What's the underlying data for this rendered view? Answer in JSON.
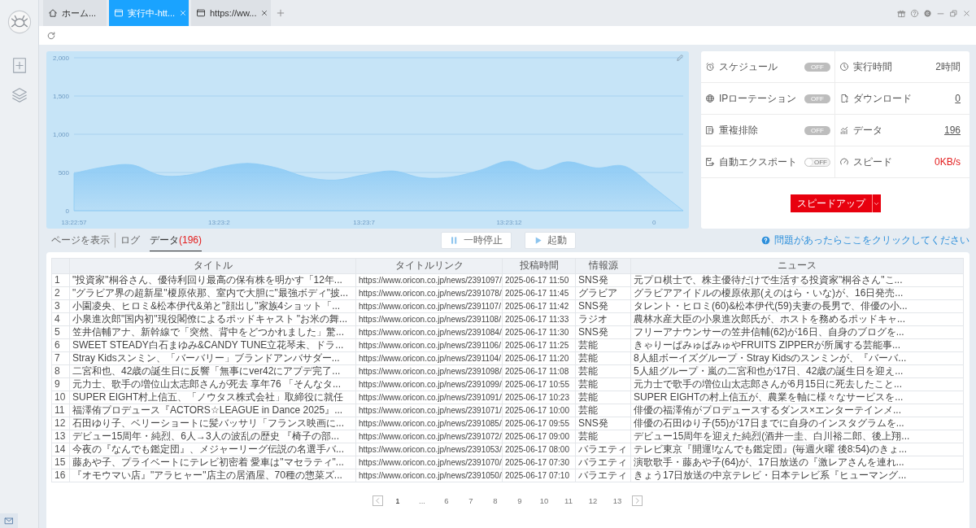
{
  "tabs": [
    {
      "label": "ホーム...",
      "kind": "home",
      "selected": false,
      "closable": false
    },
    {
      "label": "実行中-htt...",
      "kind": "page",
      "selected": true,
      "closable": true
    },
    {
      "label": "https://ww...",
      "kind": "page",
      "selected": false,
      "closable": true
    }
  ],
  "speed_chart": {
    "chart_data": {
      "type": "area",
      "categories": [
        "13:22:57",
        null,
        null,
        null,
        null,
        "13:23:2",
        null,
        null,
        null,
        null,
        "13:23:7",
        null,
        null,
        null,
        null,
        "13:23:12",
        null,
        null,
        null,
        null,
        "0",
        null
      ],
      "series": [
        {
          "color": "#8ecbf5",
          "values": [
            490,
            570,
            600,
            460,
            470,
            570,
            620,
            560,
            440,
            400,
            470,
            520,
            430,
            440,
            530,
            650,
            530,
            640,
            560,
            580,
            300,
            0
          ]
        }
      ],
      "ylim": [
        0,
        2000
      ],
      "grid": true,
      "yticks": [
        {
          "value": 0,
          "label": "0"
        },
        {
          "value": 500,
          "label": "500"
        },
        {
          "value": 1000,
          "label": "1,000"
        },
        {
          "value": 1500,
          "label": "1,500"
        },
        {
          "value": 2000,
          "label": "2,000"
        }
      ]
    }
  },
  "toggles": [
    {
      "label": "スケジュール",
      "kind": "pill",
      "state": "OFF",
      "on": false
    },
    {
      "label": "IPローテーション",
      "kind": "pill",
      "state": "OFF",
      "on": false
    },
    {
      "label": "重複排除",
      "kind": "pill",
      "state": "OFF",
      "on": false
    },
    {
      "label": "自動エクスポート",
      "kind": "switch",
      "state": "OFF",
      "on": false
    }
  ],
  "stats": [
    {
      "label": "実行時間",
      "value": "2時間",
      "kind": "text"
    },
    {
      "label": "ダウンロード",
      "value": "0",
      "kind": "link"
    },
    {
      "label": "データ",
      "value": "196",
      "kind": "link"
    },
    {
      "label": "スピード",
      "value": "0KB/s",
      "kind": "alert"
    }
  ],
  "speed_button": {
    "label": "スピードアップ"
  },
  "view_tabs": [
    {
      "label": "ページを表示",
      "selected": false
    },
    {
      "label": "ログ",
      "selected": false
    },
    {
      "label": "データ",
      "count": "(196)",
      "selected": true
    }
  ],
  "actions": [
    {
      "label": "一時停止",
      "kind": "pause"
    },
    {
      "label": "起動",
      "kind": "play"
    }
  ],
  "help_link": "問題があったらここをクリックしてください",
  "table": {
    "columns": [
      "タイトル",
      "タイトルリンク",
      "投稿時間",
      "情報源",
      "ニュース"
    ],
    "rows": [
      {
        "index": "1",
        "title": "\"投資家\"桐谷さん、優待利回り最高の保有株を明かす「12年...",
        "link": "https://www.oricon.co.jp/news/2391097/",
        "time": "2025-06-17 11:50",
        "source": "SNS発",
        "news": "元プロ棋士で、株主優待だけで生活する投資家\"桐谷さん\"こ..."
      },
      {
        "index": "2",
        "title": "\"グラビア界の超新星\"榎原依那、室内で大胆に\"最強ボディ\"披...",
        "link": "https://www.oricon.co.jp/news/2391078/",
        "time": "2025-06-17 11:45",
        "source": "グラビア",
        "news": "グラビアアイドルの榎原依那(えのはら・いな)が、16日発売..."
      },
      {
        "index": "3",
        "title": "小園凌央、ヒロミ&松本伊代&弟と\"顔出し\"家族4ショット「...",
        "link": "https://www.oricon.co.jp/news/2391107/",
        "time": "2025-06-17 11:42",
        "source": "SNS発",
        "news": "タレント・ヒロミ(60)&松本伊代(59)夫妻の長男で、俳優の小..."
      },
      {
        "index": "4",
        "title": "小泉進次郎\"国内初\"現役閣僚によるポッドキャスト \"お米の舞...",
        "link": "https://www.oricon.co.jp/news/2391108/",
        "time": "2025-06-17 11:33",
        "source": "ラジオ",
        "news": "農林水産大臣の小泉進次郎氏が、ホストを務めるポッドキャ..."
      },
      {
        "index": "5",
        "title": "笠井信輔アナ、新幹線で「突然、背中をどつかれました」驚...",
        "link": "https://www.oricon.co.jp/news/2391084/",
        "time": "2025-06-17 11:30",
        "source": "SNS発",
        "news": "フリーアナウンサーの笠井信輔(62)が16日、自身のブログを..."
      },
      {
        "index": "6",
        "title": "SWEET STEADY白石まゆみ&CANDY TUNE立花琴未、ドラ...",
        "link": "https://www.oricon.co.jp/news/2391106/",
        "time": "2025-06-17 11:25",
        "source": "芸能",
        "news": "きゃりーぱみゅぱみゅやFRUITS ZIPPERが所属する芸能事..."
      },
      {
        "index": "7",
        "title": "Stray Kidsスンミン、「バーバリー」ブランドアンバサダー...",
        "link": "https://www.oricon.co.jp/news/2391104/",
        "time": "2025-06-17 11:20",
        "source": "芸能",
        "news": "8人組ボーイズグループ・Stray Kidsのスンミンが、『バーバ..."
      },
      {
        "index": "8",
        "title": "二宮和也、42歳の誕生日に反響「無事にver42にアプデ完了...",
        "link": "https://www.oricon.co.jp/news/2391098/",
        "time": "2025-06-17 11:08",
        "source": "芸能",
        "news": "5人組グループ・嵐の二宮和也が17日、42歳の誕生日を迎え..."
      },
      {
        "index": "9",
        "title": "元力士、歌手の増位山太志郎さんが死去 享年76 「そんなタ...",
        "link": "https://www.oricon.co.jp/news/2391099/",
        "time": "2025-06-17 10:55",
        "source": "芸能",
        "news": "元力士で歌手の増位山太志郎さんが6月15日に死去したこと..."
      },
      {
        "index": "10",
        "title": "SUPER EIGHT村上信五、「ノウタス株式会社」取締役に就任",
        "link": "https://www.oricon.co.jp/news/2391091/",
        "time": "2025-06-17 10:23",
        "source": "芸能",
        "news": "SUPER EIGHTの村上信五が、農業を軸に様々なサービスを..."
      },
      {
        "index": "11",
        "title": "福澤侑プロデュース『ACTORS☆LEAGUE in Dance 2025』...",
        "link": "https://www.oricon.co.jp/news/2391071/",
        "time": "2025-06-17 10:00",
        "source": "芸能",
        "news": "俳優の福澤侑がプロデュースするダンス×エンターテインメ..."
      },
      {
        "index": "12",
        "title": "石田ゆり子、ベリーショートに髪バッサリ「フランス映画に...",
        "link": "https://www.oricon.co.jp/news/2391085/",
        "time": "2025-06-17 09:55",
        "source": "SNS発",
        "news": "俳優の石田ゆり子(55)が17日までに自身のインスタグラムを..."
      },
      {
        "index": "13",
        "title": "デビュー15周年・純烈、6人→3人の波乱の歴史 『椅子の部...",
        "link": "https://www.oricon.co.jp/news/2391072/",
        "time": "2025-06-17 09:00",
        "source": "芸能",
        "news": "デビュー15周年を迎えた純烈(酒井一圭、白川裕二郎、後上翔..."
      },
      {
        "index": "14",
        "title": "今夜の『なんでも鑑定団』、メジャーリーグ伝説の名選手バ...",
        "link": "https://www.oricon.co.jp/news/2391053/",
        "time": "2025-06-17 08:00",
        "source": "バラエティ",
        "news": "テレビ東京『開運!なんでも鑑定団』(毎週火曜 後8:54)のきょ..."
      },
      {
        "index": "15",
        "title": "藤あや子、プライベートにテレビ初密着 愛車は\"マセラティ\"...",
        "link": "https://www.oricon.co.jp/news/2391070/",
        "time": "2025-06-17 07:30",
        "source": "バラエティ",
        "news": "演歌歌手・藤あや子(64)が、17日放送の『激レアさんを連れ..."
      },
      {
        "index": "16",
        "title": "『オモウマい店』\"アラヒャー\"店主の居酒屋、70種の惣菜ズ...",
        "link": "https://www.oricon.co.jp/news/2391050/",
        "time": "2025-06-17 07:10",
        "source": "バラエティ",
        "news": "きょう17日放送の中京テレビ・日本テレビ系『ヒューマング..."
      }
    ]
  },
  "pagination": {
    "pages": [
      {
        "label": "1",
        "selected": true
      },
      {
        "label": "...",
        "selected": false
      },
      {
        "label": "6",
        "selected": false
      },
      {
        "label": "7",
        "selected": false
      },
      {
        "label": "8",
        "selected": false
      },
      {
        "label": "9",
        "selected": false
      },
      {
        "label": "10",
        "selected": false
      },
      {
        "label": "11",
        "selected": false
      },
      {
        "label": "12",
        "selected": false
      },
      {
        "label": "13",
        "selected": false
      }
    ]
  }
}
